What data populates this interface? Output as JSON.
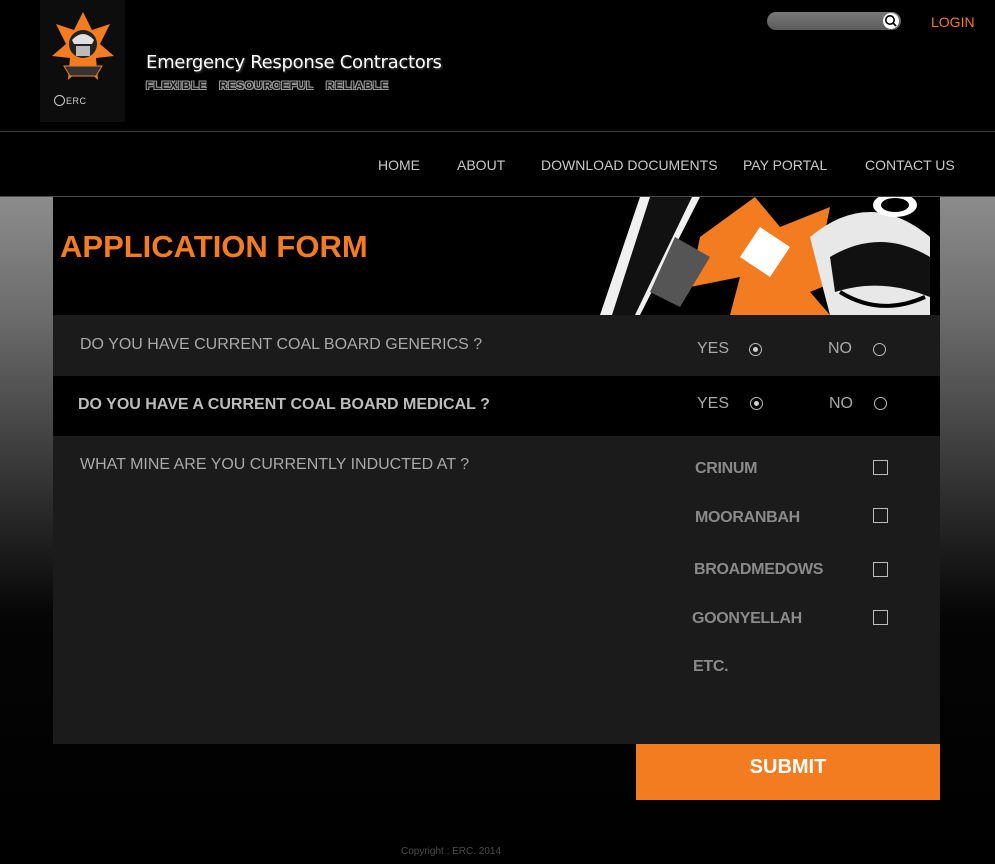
{
  "header": {
    "brand_name": "Emergency Response Contractors",
    "tagline": [
      "FLEXIBLE",
      "RESOURCEFUL",
      "RELIABLE"
    ],
    "logo_text": "ERC",
    "search": {
      "placeholder": "",
      "icon": "search-icon"
    },
    "login_label": "LOGIN"
  },
  "nav": {
    "items": [
      {
        "label": "HOME"
      },
      {
        "label": "ABOUT"
      },
      {
        "label": "DOWNLOAD DOCUMENTS"
      },
      {
        "label": "PAY PORTAL"
      },
      {
        "label": "CONTACT US"
      }
    ]
  },
  "form": {
    "title": "APPLICATION FORM",
    "questions": [
      {
        "text": "DO YOU HAVE CURRENT COAL BOARD GENERICS ?",
        "options": [
          "YES",
          "NO"
        ],
        "selected": "YES"
      },
      {
        "text": "DO YOU HAVE A CURRENT  COAL BOARD MEDICAL ?",
        "options": [
          "YES",
          "NO"
        ],
        "selected": "YES"
      }
    ],
    "mine_question": "WHAT MINE ARE YOU CURRENTLY INDUCTED AT ?",
    "mines": [
      {
        "label": "CRINUM",
        "checked": false
      },
      {
        "label": "MOORANBAH",
        "checked": false
      },
      {
        "label": "BROADMEDOWS",
        "checked": false
      },
      {
        "label": "GOONYELLAH",
        "checked": false
      },
      {
        "label": "ETC."
      }
    ],
    "submit_label": "SUBMIT"
  },
  "footer": {
    "copyright": "Copyright : ERC. 2014"
  },
  "colors": {
    "accent": "#f47c20",
    "background": "#000000",
    "panel": "#1b1b1b"
  }
}
